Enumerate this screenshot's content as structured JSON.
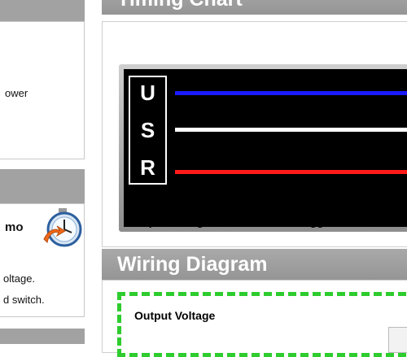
{
  "sidebar": {
    "panel1_text": "ower",
    "panel2_title": "mo",
    "panel2_line1": "oltage.",
    "panel2_line2": "d switch."
  },
  "timing": {
    "header": "Timing Chart",
    "channels": [
      "U",
      "S",
      "R"
    ],
    "trace_colors": [
      "#1a1aff",
      "#ffffff",
      "#ff1a1a"
    ],
    "legend": [
      "U=Input Voltage",
      "S=Switch Trigger",
      "R=Rela"
    ]
  },
  "wiring": {
    "header": "Wiring Diagram",
    "output_label": "Output Voltage"
  }
}
